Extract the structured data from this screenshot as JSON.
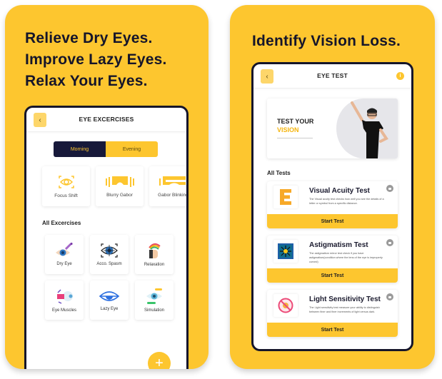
{
  "left_panel": {
    "headline": [
      "Relieve Dry Eyes.",
      "Improve Lazy Eyes.",
      "Relax Your Eyes."
    ],
    "screen": {
      "title": "EYE EXCERCISES",
      "back_icon": "chevron-left-icon",
      "tabs": [
        {
          "label": "Morning",
          "active": true
        },
        {
          "label": "Evening",
          "active": false
        }
      ],
      "featured": [
        {
          "label": "Focus Shift",
          "icon": "eye-focus-icon"
        },
        {
          "label": "Blurry Gabor",
          "icon": "goggles-icon"
        },
        {
          "label": "Gabor Blinking",
          "icon": "vr-goggles-icon"
        }
      ],
      "all_section_title": "All Excercises",
      "exercises": [
        {
          "label": "Dry Eye",
          "icon": "eye-drop-icon"
        },
        {
          "label": "Acco. Spasm",
          "icon": "eye-target-icon"
        },
        {
          "label": "Relaxation",
          "icon": "relaxed-head-icon"
        },
        {
          "label": "Eye Muscles",
          "icon": "eye-muscles-icon"
        },
        {
          "label": "Lazy Eye",
          "icon": "lazy-eye-icon"
        },
        {
          "label": "Simulation",
          "icon": "eye-simulation-icon"
        }
      ],
      "fab_label": "+"
    }
  },
  "right_panel": {
    "headline": "Identify Vision Loss.",
    "screen": {
      "title": "EYE TEST",
      "back_icon": "chevron-left-icon",
      "info_label": "i",
      "banner": {
        "line1": "TEST YOUR",
        "line2": "VISION"
      },
      "all_section_title": "All Tests",
      "tests": [
        {
          "name": "Visual Acuity Test",
          "description": "The Visual acuity test checks how well you see the details of a letter or symbol from a specific distance.",
          "button": "Start Test",
          "icon": "letter-e-icon"
        },
        {
          "name": "Astigmatism Test",
          "description": "The astigmatism mirror test check if you have astigmatism(condition where the lens of the eye is improperly curved)",
          "button": "Start Test",
          "icon": "astigmatism-chart-icon"
        },
        {
          "name": "Light Sensitivity Test",
          "description": "The Light sensitivity test measure your ability to distinguish between finer and finer increments of light versus dark.",
          "button": "Start Test",
          "icon": "no-light-icon"
        }
      ]
    }
  },
  "colors": {
    "accent": "#fdc62f",
    "dark": "#17193a"
  }
}
